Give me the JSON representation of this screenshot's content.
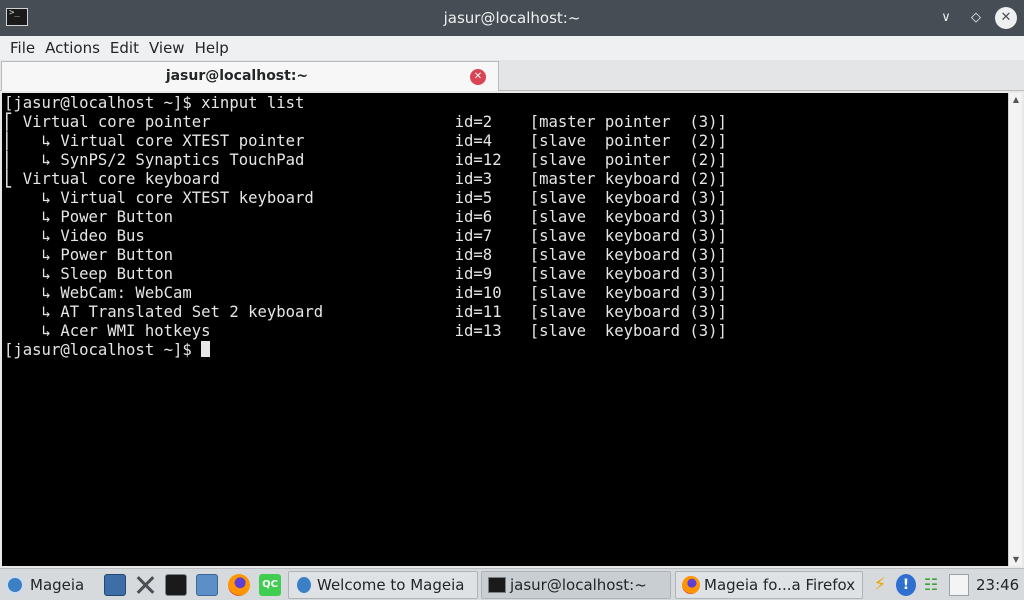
{
  "window": {
    "title": "jasur@localhost:~",
    "icons": [
      "terminal-icon",
      "chevron-down-icon",
      "diamond-icon",
      "close-icon"
    ]
  },
  "menu": [
    "File",
    "Actions",
    "Edit",
    "View",
    "Help"
  ],
  "tab": {
    "label": "jasur@localhost:~"
  },
  "terminal": {
    "lines": [
      "[jasur@localhost ~]$ xinput list",
      "⎡ Virtual core pointer                    \tid=2\t[master pointer  (3)]",
      "⎜   ↳ Virtual core XTEST pointer              \tid=4\t[slave  pointer  (2)]",
      "⎜   ↳ SynPS/2 Synaptics TouchPad              \tid=12\t[slave  pointer  (2)]",
      "⎣ Virtual core keyboard                   \tid=3\t[master keyboard (2)]",
      "    ↳ Virtual core XTEST keyboard             \tid=5\t[slave  keyboard (3)]",
      "    ↳ Power Button                            \tid=6\t[slave  keyboard (3)]",
      "    ↳ Video Bus                               \tid=7\t[slave  keyboard (3)]",
      "    ↳ Power Button                            \tid=8\t[slave  keyboard (3)]",
      "    ↳ Sleep Button                            \tid=9\t[slave  keyboard (3)]",
      "    ↳ WebCam: WebCam                          \tid=10\t[slave  keyboard (3)]",
      "    ↳ AT Translated Set 2 keyboard            \tid=11\t[slave  keyboard (3)]",
      "    ↳ Acer WMI hotkeys                        \tid=13\t[slave  keyboard (3)]"
    ],
    "prompt": "[jasur@localhost ~]$ "
  },
  "taskbar": {
    "start_label": "Mageia",
    "tasks": [
      {
        "label": "Welcome to Mageia",
        "icon": "mageia-icon"
      },
      {
        "label": "jasur@localhost:~",
        "icon": "terminal-icon"
      },
      {
        "label": "Mageia fo...a Firefox",
        "icon": "firefox-icon"
      }
    ],
    "launchers": [
      "desktop-icon",
      "tools-icon",
      "konsole-icon",
      "file-manager-icon",
      "firefox-icon",
      "qt-creator-icon"
    ],
    "tray": [
      "power-icon",
      "updates-icon",
      "wifi-icon",
      "notes-icon"
    ],
    "clock": "23:46"
  }
}
